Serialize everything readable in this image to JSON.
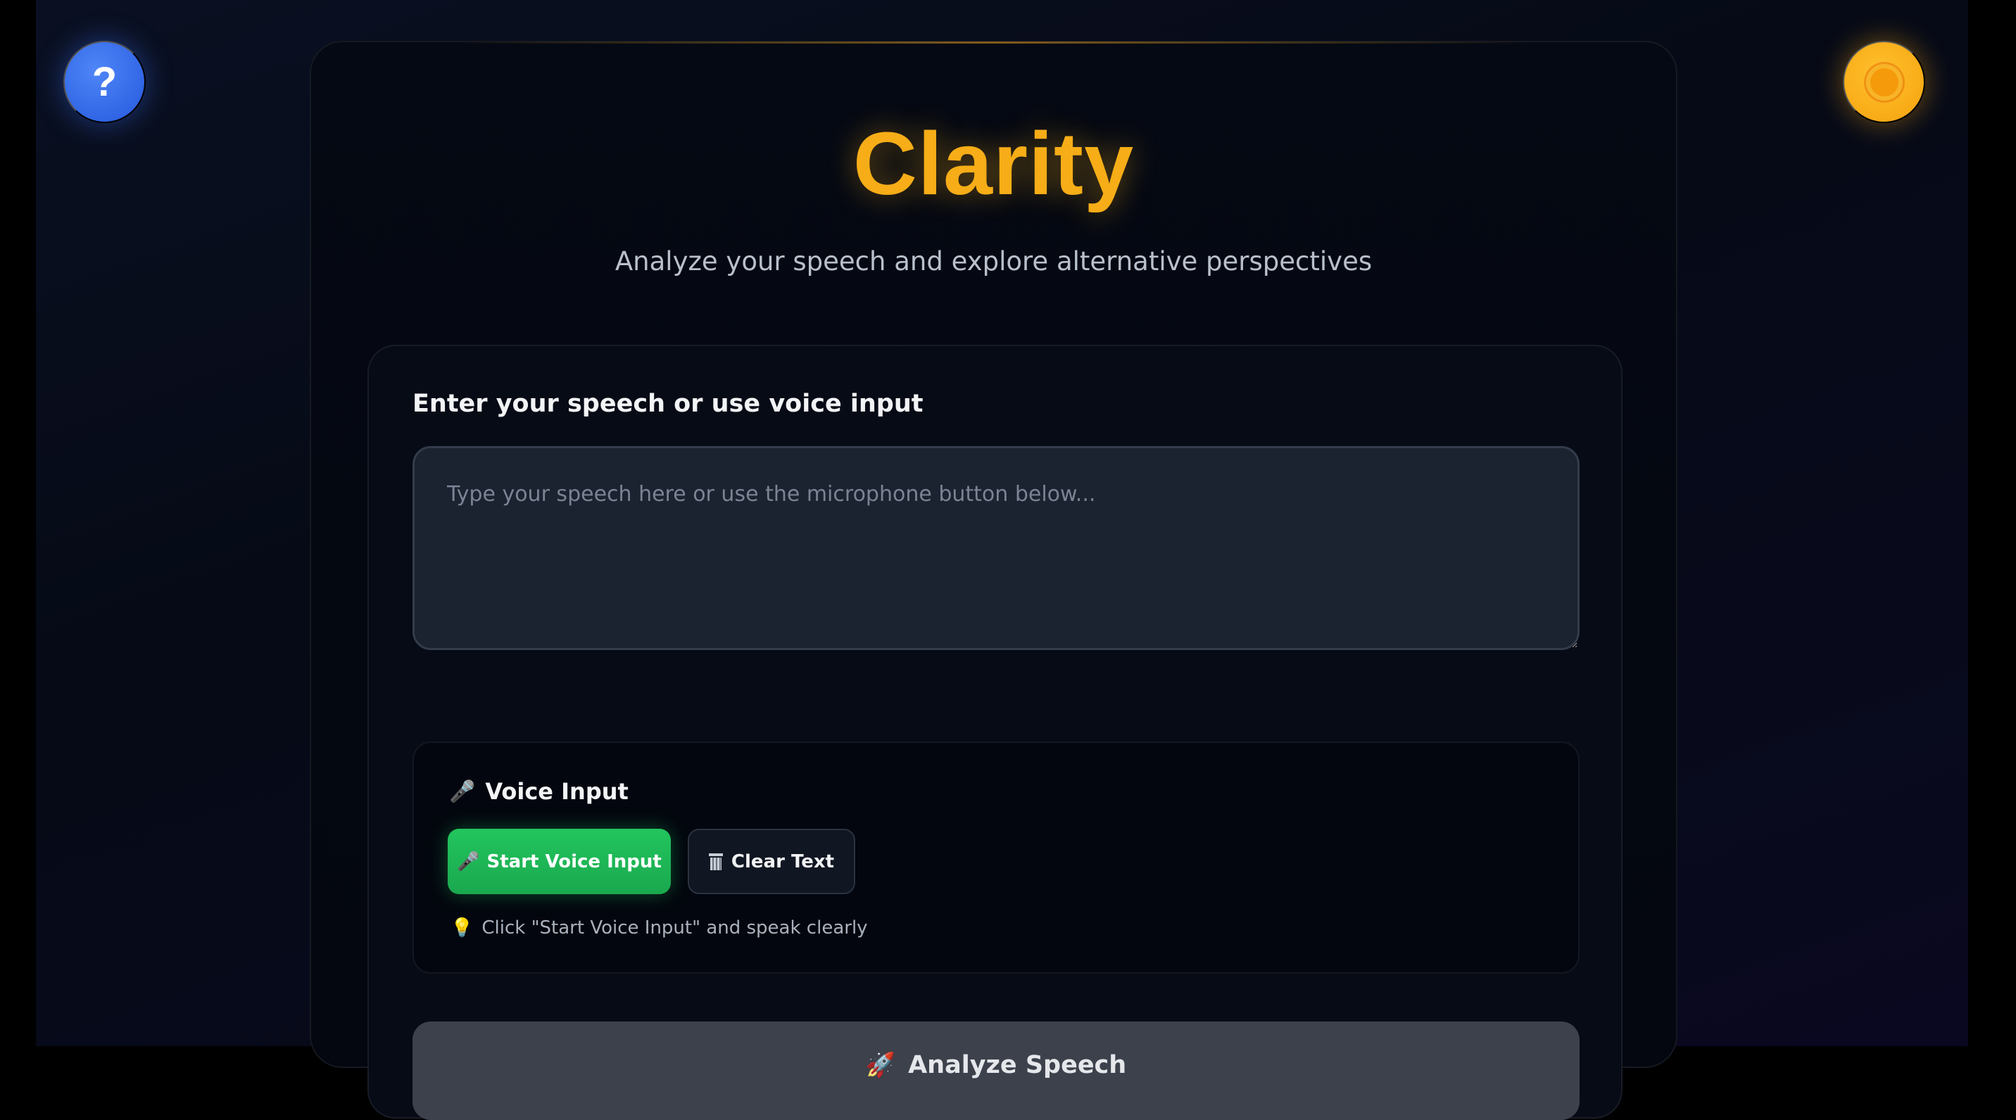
{
  "app": {
    "title": "Clarity",
    "subtitle": "Analyze your speech and explore alternative perspectives",
    "accent_color": "#f6ad17"
  },
  "header": {
    "help_label": "?",
    "help_icon": "question-mark-icon",
    "theme_icon": "sun-icon"
  },
  "input": {
    "label": "Enter your speech or use voice input",
    "placeholder": "Type your speech here or use the microphone button below...",
    "value": ""
  },
  "voice": {
    "title_icon": "🎤",
    "title": "Voice Input",
    "start_icon": "🎤",
    "start_label": "Start Voice Input",
    "start_color": "#22c55e",
    "clear_label": "Clear Text",
    "hint_icon": "💡",
    "hint": "Click \"Start Voice Input\" and speak clearly"
  },
  "analyze": {
    "icon": "🚀",
    "label": "Analyze Speech"
  }
}
